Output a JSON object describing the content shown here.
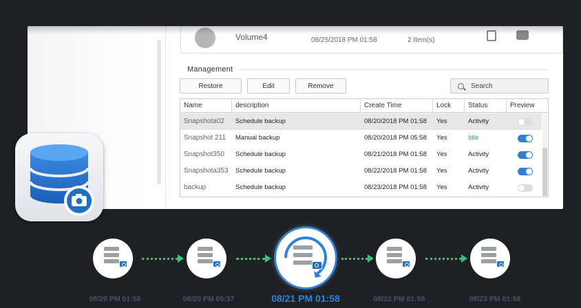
{
  "volume": {
    "name": "Volume4",
    "time": "08/25/2018 PM 01:58",
    "items": "2 Item(s)"
  },
  "management": {
    "title": "Management",
    "buttons": {
      "restore": "Restore",
      "edit": "Edit",
      "remove": "Remove"
    },
    "search_placeholder": "Search"
  },
  "table": {
    "headers": {
      "name": "Name",
      "description": "description",
      "create_time": "Create Time",
      "lock": "Lock",
      "status": "Status",
      "preview": "Preview"
    },
    "rows": [
      {
        "name": "Snapshota02",
        "description": "Schedule backup",
        "create_time": "08/20/2018 PM 01:58",
        "lock": "Yes",
        "status": "Activity",
        "preview_on": false,
        "selected": true
      },
      {
        "name": "Snapshot 211",
        "description": "Manual backup",
        "create_time": "08/20/2018 PM 05:58",
        "lock": "Yes",
        "status": "Idle",
        "preview_on": true,
        "selected": false
      },
      {
        "name": "Snapshot350",
        "description": "Schedule backup",
        "create_time": "08/21/2018 PM 01:58",
        "lock": "Yes",
        "status": "Activity",
        "preview_on": true,
        "selected": false
      },
      {
        "name": "Snapshota353",
        "description": "Schedule backup",
        "create_time": "08/22/2018 PM 01:58",
        "lock": "Yes",
        "status": "Activity",
        "preview_on": true,
        "selected": false
      },
      {
        "name": "backup",
        "description": "Schedule backup",
        "create_time": "08/23/2018 PM 01:58",
        "lock": "Yes",
        "status": "Activity",
        "preview_on": false,
        "selected": false
      }
    ]
  },
  "timeline": {
    "labels": [
      "08/20 PM 01:58",
      "08/20 PM 05:37",
      "08/21 PM 01:58",
      "08/22 PM 01:58",
      "08/23 PM 01:58"
    ],
    "active_index": 2
  },
  "colors": {
    "accent": "#2f82d8",
    "arrow": "#37c47a",
    "idle": "#2aa64d",
    "background": "#1f2023"
  },
  "icons": [
    "snapshot-app-icon",
    "database-icon",
    "camera-icon",
    "server-icon",
    "search-icon",
    "refresh-icon"
  ]
}
